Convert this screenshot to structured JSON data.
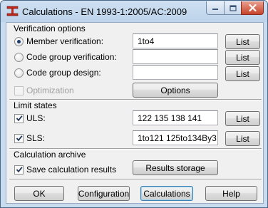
{
  "window": {
    "title": "Calculations - EN 1993-1:2005/AC:2009"
  },
  "verification": {
    "section_title": "Verification options",
    "member_label": "Member verification:",
    "member_value": "1to4",
    "code_group_ver_label": "Code group verification:",
    "code_group_ver_value": "",
    "code_group_design_label": "Code group design:",
    "code_group_design_value": "",
    "optimization_label": "Optimization",
    "options_button": "Options",
    "list_button": "List",
    "selected": "member"
  },
  "limit_states": {
    "section_title": "Limit states",
    "uls_label": "ULS:",
    "uls_value": "122 135 138 141",
    "sls_label": "SLS:",
    "sls_value": "1to121 125to134By3",
    "list_button": "List"
  },
  "archive": {
    "section_title": "Calculation archive",
    "save_label": "Save calculation results",
    "results_button": "Results storage"
  },
  "footer": {
    "ok": "OK",
    "configuration": "Configuration",
    "calculations": "Calculations",
    "help": "Help"
  }
}
